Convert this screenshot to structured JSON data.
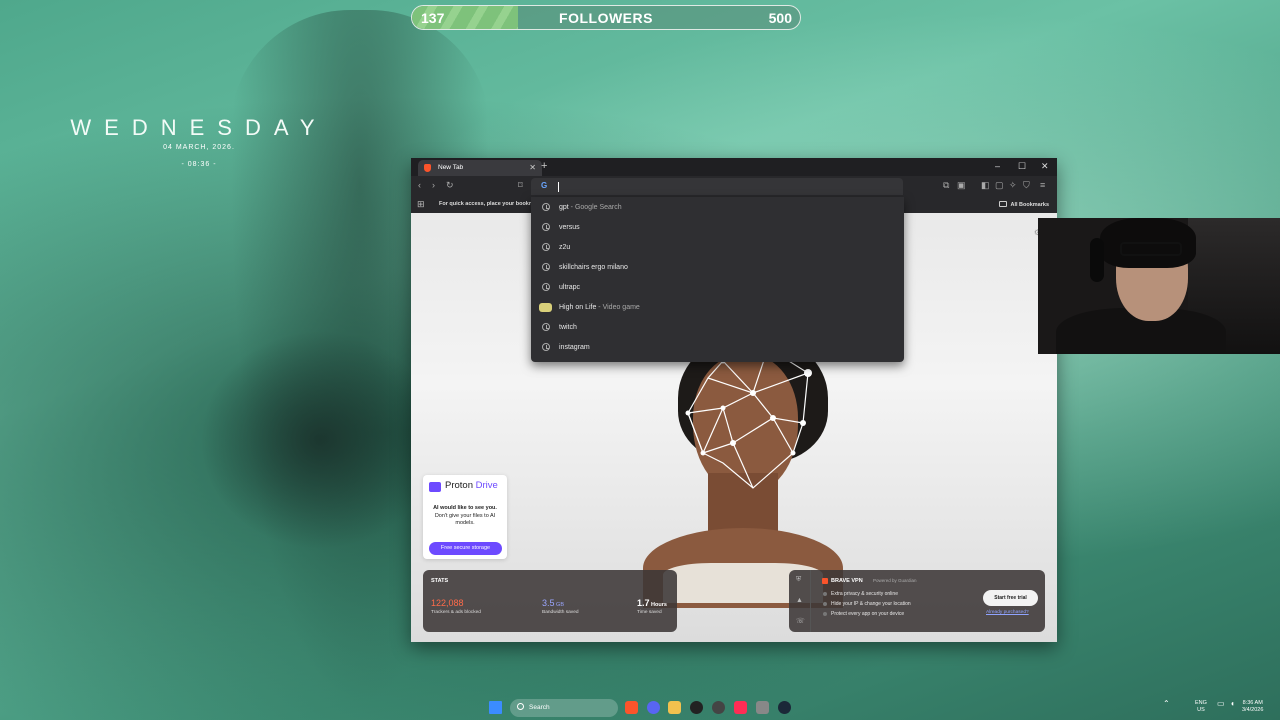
{
  "overlay": {
    "followers": {
      "current": "137",
      "title": "FOLLOWERS",
      "goal": "500",
      "progress_fraction": 0.274
    }
  },
  "desktop_widget": {
    "day": "WEDNESDAY",
    "date": "04 MARCH, 2026.",
    "time": "- 08:36 -"
  },
  "browser": {
    "tab_title": "New Tab",
    "new_tab_symbol": "+",
    "window_controls": [
      "–",
      "☐",
      "✕"
    ],
    "bookmarks_bar": {
      "hint": "For quick access, place your bookm",
      "all_bookmarks": "All Bookmarks"
    },
    "omnibox": {
      "suggestions": [
        {
          "text": "gpt",
          "sub": " - Google Search",
          "icon": "history-icon"
        },
        {
          "text": "versus",
          "sub": "",
          "icon": "history-icon"
        },
        {
          "text": "z2u",
          "sub": "",
          "icon": "history-icon"
        },
        {
          "text": "skillchairs ergo milano",
          "sub": "",
          "icon": "history-icon"
        },
        {
          "text": "ultrapc",
          "sub": "",
          "icon": "history-icon"
        },
        {
          "text": "High on Life",
          "sub": " - Video game",
          "icon": "game-thumbnail-icon"
        },
        {
          "text": "twitch",
          "sub": "",
          "icon": "history-icon"
        },
        {
          "text": "instagram",
          "sub": "",
          "icon": "history-icon"
        }
      ]
    },
    "ntp": {
      "proton": {
        "brand_a": "Proton",
        "brand_b": " Drive",
        "msg_bold": "AI would like to see you.",
        "msg_rest": "Don't give your files to AI models.",
        "cta": "Free secure storage"
      },
      "stats": {
        "title": "STATS",
        "items": [
          {
            "value": "122,088",
            "unit": "",
            "label": "Trackers & ads blocked"
          },
          {
            "value": "3.5",
            "unit": " GB",
            "label": "Bandwidth saved"
          },
          {
            "value": "1.7",
            "unit": " Hours",
            "label": "Time saved"
          }
        ]
      },
      "vpn": {
        "title": "BRAVE VPN",
        "powered": "Powered by Guardian",
        "features": [
          "Extra privacy & security online",
          "Hide your IP & change your location",
          "Protect every app on your device"
        ],
        "trial": "Start free trial",
        "already": "Already purchased?"
      }
    }
  },
  "taskbar": {
    "search_label": "Search",
    "tray": {
      "lang": "ENG",
      "region": "US",
      "time": "8:36 AM",
      "date": "3/4/2026"
    }
  },
  "colors": {
    "accent_brave": "#fb542b",
    "proton_purple": "#6d4aff",
    "trackers_value": "#ff6b4a",
    "bandwidth_value": "#9aa6ff"
  }
}
